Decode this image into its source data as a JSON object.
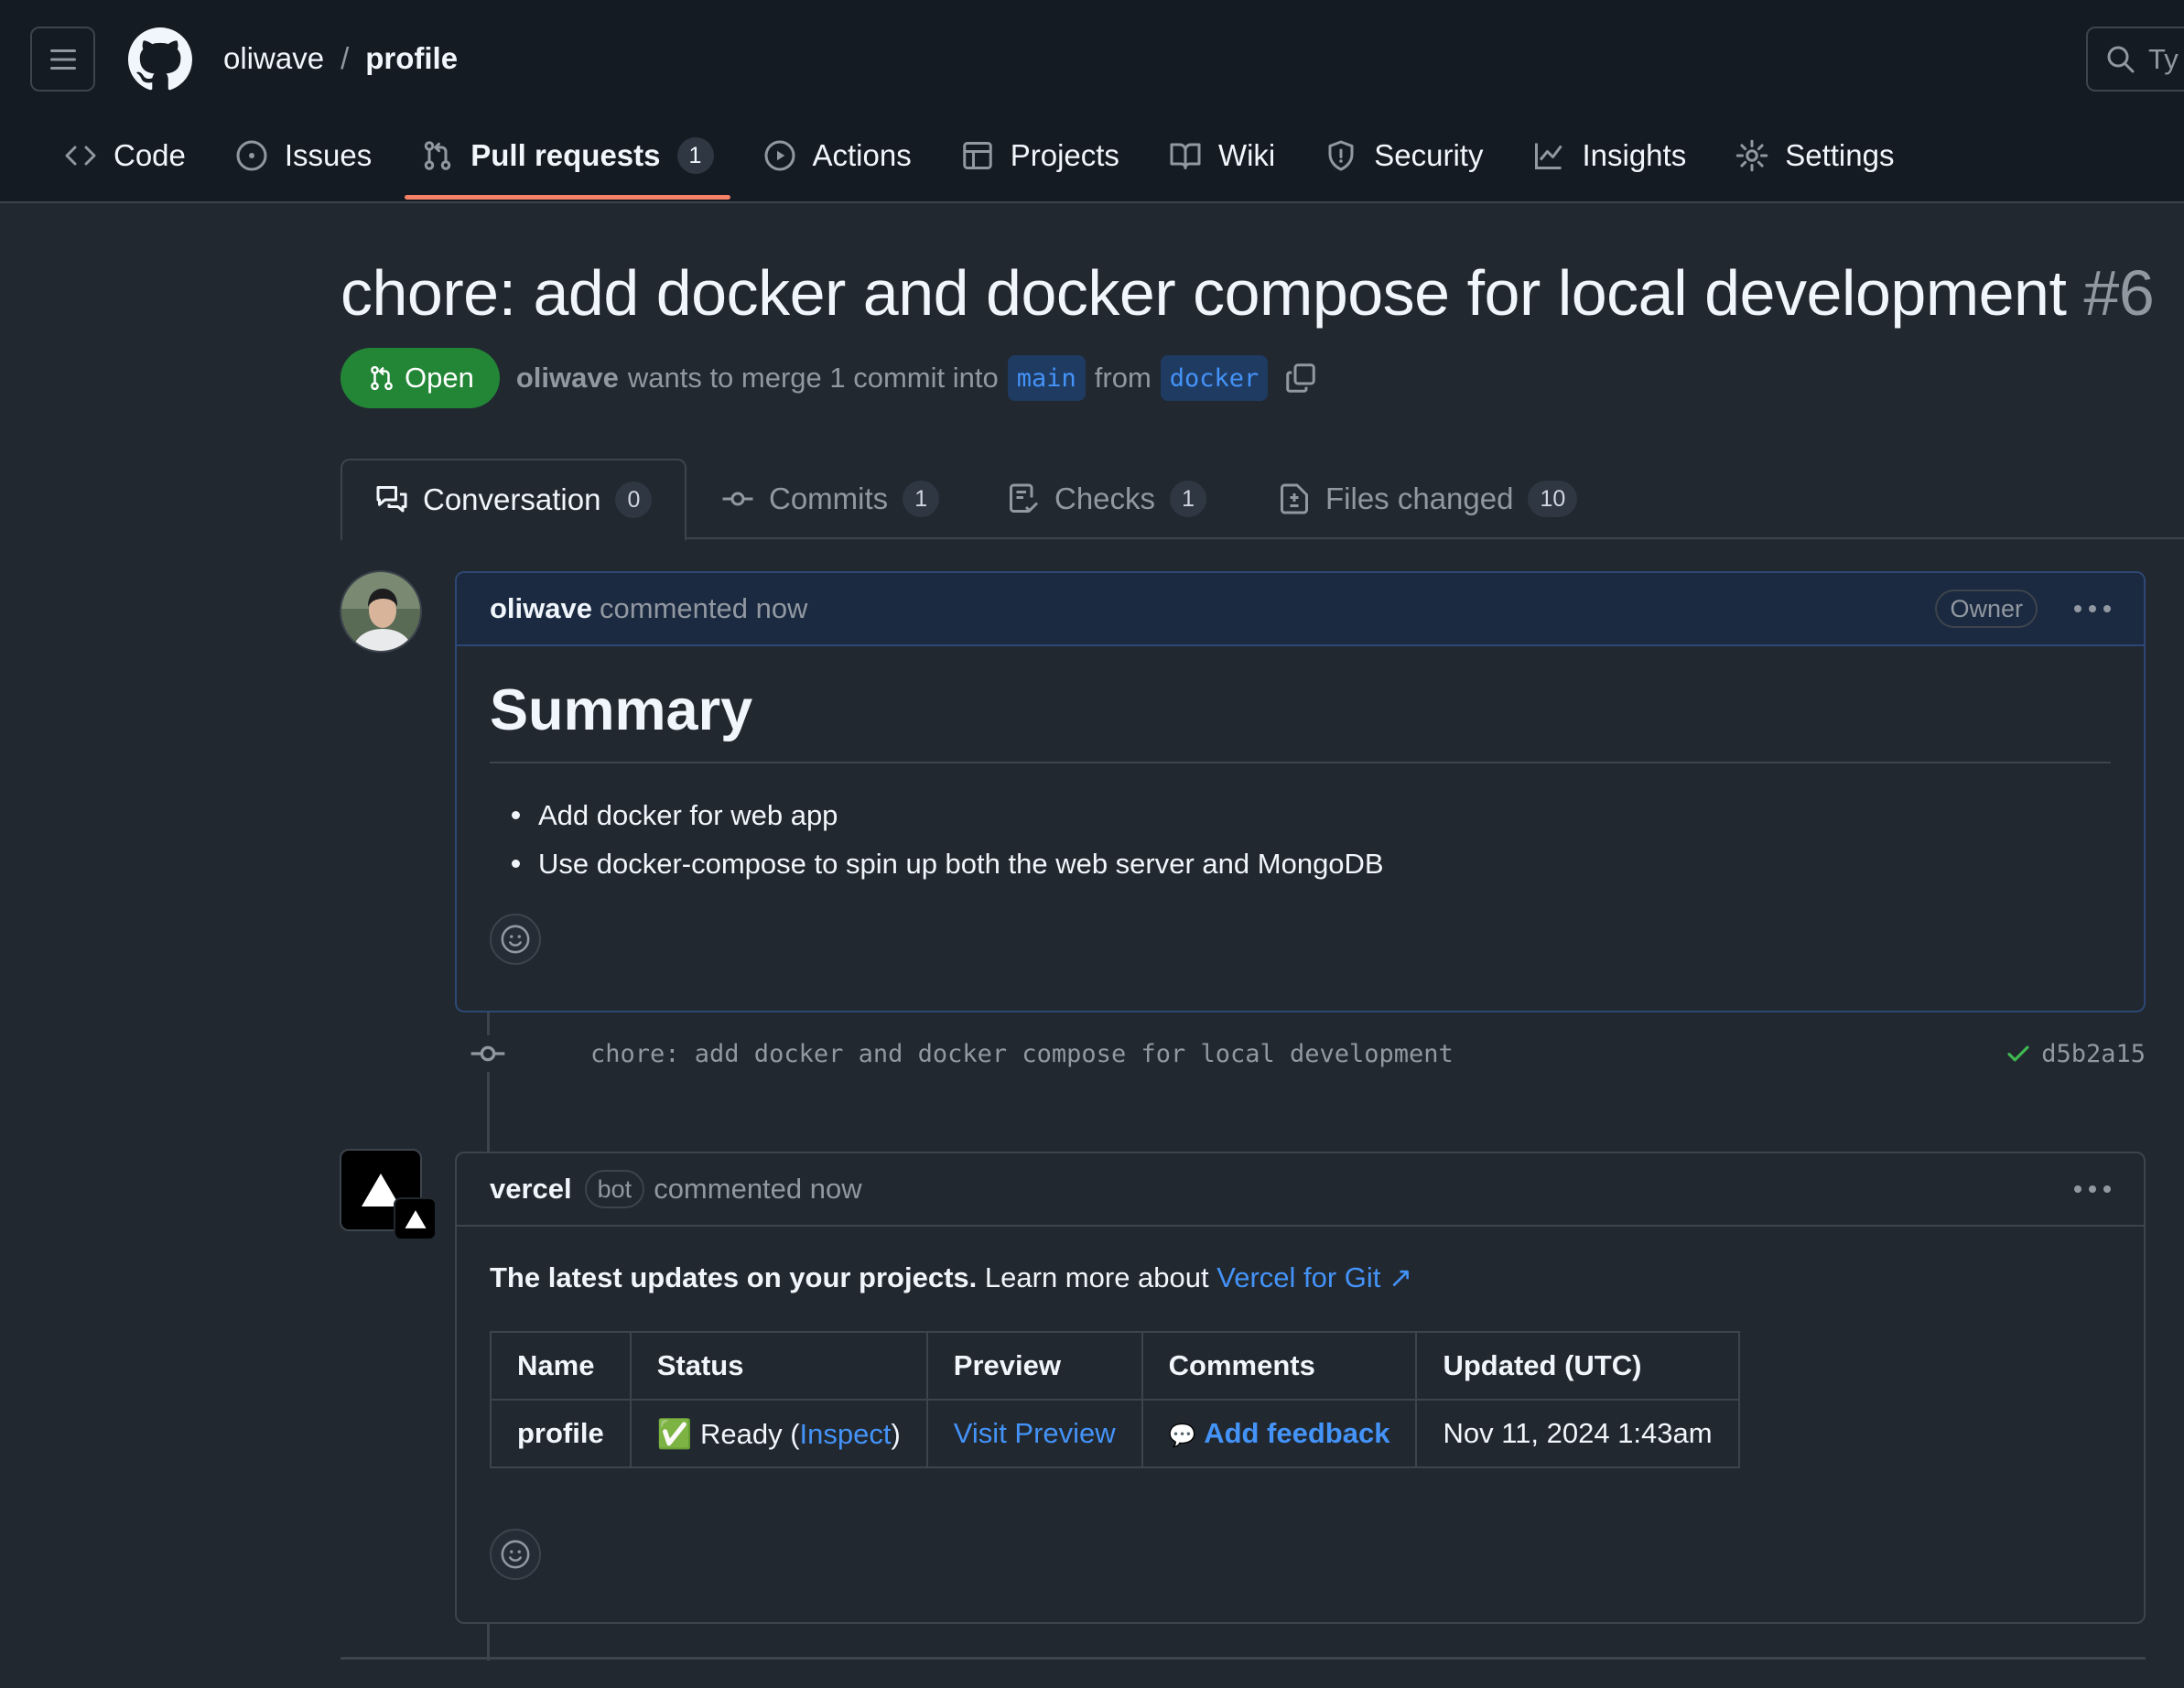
{
  "header": {
    "owner": "oliwave",
    "separator": "/",
    "repo": "profile",
    "search_placeholder": "Ty"
  },
  "repo_nav": {
    "code": "Code",
    "issues": "Issues",
    "pull_requests": "Pull requests",
    "pull_requests_count": "1",
    "actions": "Actions",
    "projects": "Projects",
    "wiki": "Wiki",
    "security": "Security",
    "insights": "Insights",
    "settings": "Settings"
  },
  "pr": {
    "title": "chore: add docker and docker compose for local development",
    "number": "#6",
    "state": "Open",
    "author": "oliwave",
    "merge_text": "wants to merge 1 commit into",
    "base_branch": "main",
    "from_text": "from",
    "head_branch": "docker"
  },
  "pr_tabs": {
    "conversation": "Conversation",
    "conversation_count": "0",
    "commits": "Commits",
    "commits_count": "1",
    "checks": "Checks",
    "checks_count": "1",
    "files": "Files changed",
    "files_count": "10"
  },
  "comment1": {
    "author": "oliwave",
    "time": "commented now",
    "badge": "Owner",
    "heading": "Summary",
    "bullets": [
      "Add docker for web app",
      "Use docker-compose to spin up both the web server and MongoDB"
    ]
  },
  "commit": {
    "message": "chore: add docker and docker compose for local development",
    "sha": "d5b2a15"
  },
  "comment2": {
    "author": "vercel",
    "bot_label": "bot",
    "time": "commented now",
    "lead_bold": "The latest updates on your projects.",
    "lead_rest": "Learn more about",
    "link": "Vercel for Git ↗",
    "table": {
      "headers": [
        "Name",
        "Status",
        "Preview",
        "Comments",
        "Updated (UTC)"
      ],
      "row": {
        "name": "profile",
        "status_emoji": "✅",
        "status_text": "Ready (",
        "status_link": "Inspect",
        "status_close": ")",
        "preview": "Visit Preview",
        "comments_emoji": "💬",
        "comments_link": "Add feedback",
        "updated": "Nov 11, 2024 1:43am"
      }
    }
  },
  "colors": {
    "header_bg": "#151b23",
    "page_bg": "#212830",
    "open_green": "#238636",
    "link_blue": "#4493f8",
    "tab_underline": "#f78166"
  }
}
